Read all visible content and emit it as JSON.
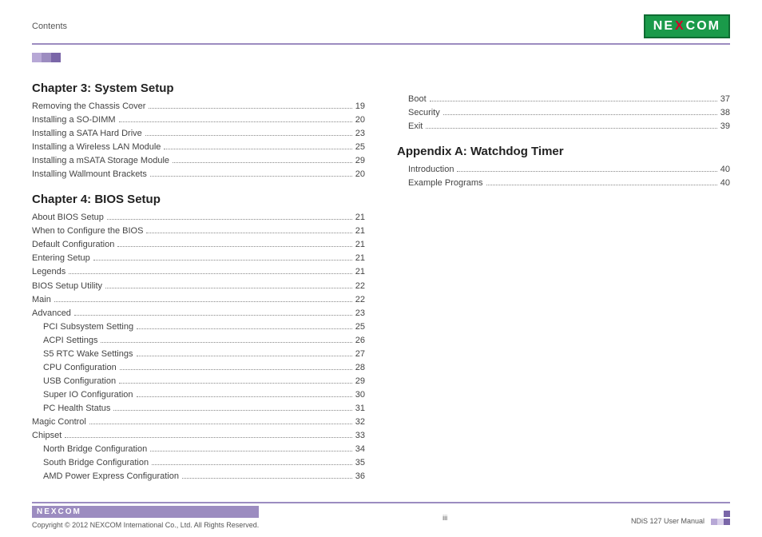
{
  "header": {
    "section_label": "Contents",
    "logo_text_pre": "NE",
    "logo_text_x": "X",
    "logo_text_post": "COM"
  },
  "sections": {
    "ch3": {
      "title": "Chapter 3: System Setup",
      "items": [
        {
          "label": "Removing the Chassis Cover",
          "page": "19",
          "indent": 0
        },
        {
          "label": "Installing a SO-DIMM",
          "page": "20",
          "indent": 0
        },
        {
          "label": "Installing a SATA Hard Drive",
          "page": "23",
          "indent": 0
        },
        {
          "label": "Installing a Wireless LAN Module",
          "page": "25",
          "indent": 0
        },
        {
          "label": "Installing a mSATA Storage Module",
          "page": "29",
          "indent": 0
        },
        {
          "label": "Installing Wallmount Brackets",
          "page": "20",
          "indent": 0
        }
      ]
    },
    "ch4": {
      "title": "Chapter 4: BIOS Setup",
      "items": [
        {
          "label": "About BIOS Setup",
          "page": "21",
          "indent": 0
        },
        {
          "label": "When to Configure the BIOS",
          "page": "21",
          "indent": 0
        },
        {
          "label": "Default Configuration",
          "page": "21",
          "indent": 0
        },
        {
          "label": "Entering Setup",
          "page": "21",
          "indent": 0
        },
        {
          "label": "Legends",
          "page": "21",
          "indent": 0
        },
        {
          "label": "BIOS Setup Utility",
          "page": "22",
          "indent": 0
        },
        {
          "label": "Main",
          "page": "22",
          "indent": 0
        },
        {
          "label": "Advanced",
          "page": "23",
          "indent": 0
        },
        {
          "label": "PCI Subsystem Setting",
          "page": "25",
          "indent": 1
        },
        {
          "label": "ACPI Settings",
          "page": "26",
          "indent": 1
        },
        {
          "label": "S5 RTC Wake Settings",
          "page": "27",
          "indent": 1
        },
        {
          "label": "CPU Configuration",
          "page": "28",
          "indent": 1
        },
        {
          "label": "USB Configuration",
          "page": "29",
          "indent": 1
        },
        {
          "label": "Super IO Configuration",
          "page": "30",
          "indent": 1
        },
        {
          "label": "PC Health Status",
          "page": "31",
          "indent": 1
        },
        {
          "label": "Magic Control",
          "page": "32",
          "indent": 0
        },
        {
          "label": "Chipset",
          "page": "33",
          "indent": 0
        },
        {
          "label": "North Bridge Configuration",
          "page": "34",
          "indent": 1
        },
        {
          "label": "South Bridge Configuration",
          "page": "35",
          "indent": 1
        },
        {
          "label": "AMD Power Express Configuration",
          "page": "36",
          "indent": 1
        }
      ]
    },
    "ch4b": {
      "items": [
        {
          "label": "Boot",
          "page": "37",
          "indent": 1
        },
        {
          "label": "Security",
          "page": "38",
          "indent": 1
        },
        {
          "label": "Exit",
          "page": "39",
          "indent": 1
        }
      ]
    },
    "appA": {
      "title": "Appendix A: Watchdog Timer",
      "items": [
        {
          "label": "Introduction",
          "page": "40",
          "indent": 1
        },
        {
          "label": "Example Programs",
          "page": "40",
          "indent": 1
        }
      ]
    }
  },
  "footer": {
    "logo": "NEXCOM",
    "copyright": "Copyright © 2012 NEXCOM International Co., Ltd. All Rights Reserved.",
    "page_num": "iii",
    "doc": "NDiS 127 User Manual"
  }
}
